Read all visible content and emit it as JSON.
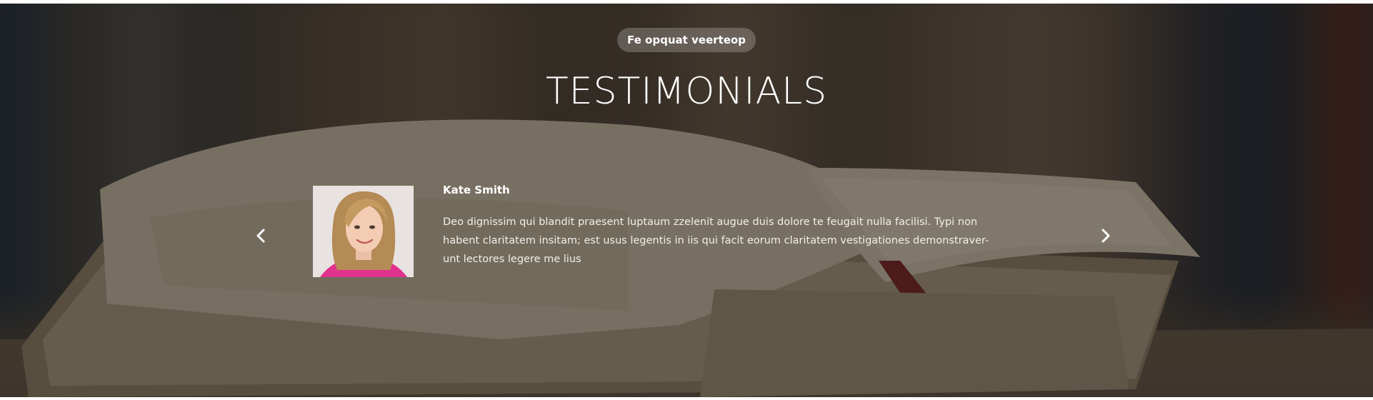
{
  "section": {
    "eyebrow": "Fe opquat veerteop",
    "title": "TESTIMONIALS"
  },
  "testimonial": {
    "name": "Kate Smith",
    "quote": "Deo dignissim qui blandit praesent luptaum zzelenit augue duis dolore te feugait nulla facilisi. Typi non habent claritatem insitam; est usus legentis in iis qui facit eorum claritatem vestigationes demonstraver-unt lectores legere me lius"
  },
  "controls": {
    "prev_icon": "chevron-left-icon",
    "next_icon": "chevron-right-icon"
  },
  "colors": {
    "overlay": "#141210",
    "text": "#ffffff",
    "eyebrow_bg": "#ffffff38"
  }
}
